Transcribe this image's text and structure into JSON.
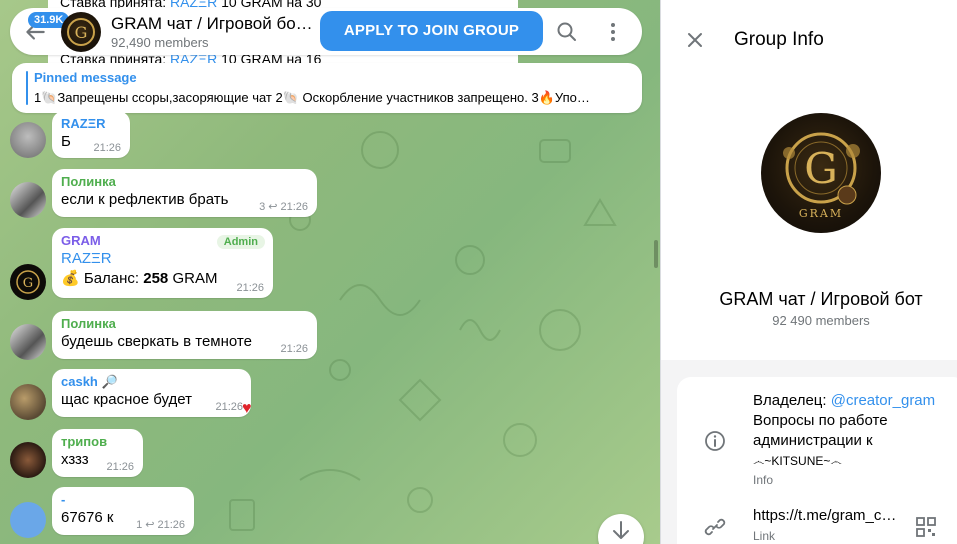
{
  "header": {
    "unread_count": "31.9K",
    "title": "GRAM чат / Игровой бо…",
    "members": "92,490 members",
    "join_label": "APPLY TO JOIN GROUP"
  },
  "background_lines": {
    "line1_prefix": "Ставка принята: ",
    "line1_user": "RAZΞR",
    "line1_suffix": " 10 GRAM на 30",
    "line2_prefix": "Ставка принята: ",
    "line2_user": "RAZΞR",
    "line2_suffix": " 10 GRAM на 16"
  },
  "pinned": {
    "label": "Pinned message",
    "text": "1🐚Запрещены ссоры,засоряющие чат 2🐚 Оскорбление участников запрещено. 3🔥Упо…"
  },
  "messages": [
    {
      "sender": "RAZΞR",
      "text": "Б",
      "time": "21:26",
      "color": "#3390ec"
    },
    {
      "sender": "Полинка",
      "text": "если к рефлектив брать",
      "replies": "3",
      "time": "21:26",
      "color": "#4fae4e"
    },
    {
      "sender": "GRAM",
      "admin": "Admin",
      "line1": "RAZΞR",
      "balance_prefix": "💰 Баланс: ",
      "balance_value": "258",
      "balance_suffix": " GRAM",
      "time": "21:26",
      "color": "#7b5de8"
    },
    {
      "sender": "Полинка",
      "text": "будешь сверкать в темноте",
      "time": "21:26",
      "color": "#4fae4e"
    },
    {
      "sender": "caskh 🔎",
      "text": "щас красное будет",
      "time": "21:26",
      "color": "#3390ec",
      "reaction": "♥"
    },
    {
      "sender": "трипов",
      "text": "хззз",
      "time": "21:26",
      "color": "#4fae4e"
    },
    {
      "sender": "-",
      "text": "67676 к",
      "replies": "1",
      "time": "21:26",
      "color": "#3390ec"
    }
  ],
  "panel": {
    "title": "Group Info",
    "group_name": "GRAM чат / Игровой бот",
    "members": "92 490 members",
    "info": {
      "owner_prefix": "Владелец: ",
      "owner_link": "@creator_gram",
      "body": "Вопросы по работе администрации к",
      "signature": "෴~KITSUNE~෴",
      "label": "Info"
    },
    "link": {
      "url": "https://t.me/gram_c…",
      "label": "Link"
    }
  },
  "colors": {
    "accent": "#3390ec",
    "admin_green": "#4fae4e",
    "chat_bg": "#8fb97c"
  },
  "icons": [
    "back-arrow-icon",
    "search-icon",
    "more-vertical-icon",
    "close-icon",
    "info-icon",
    "link-icon",
    "qr-code-icon",
    "arrow-down-icon",
    "reply-icon",
    "heart-icon"
  ]
}
